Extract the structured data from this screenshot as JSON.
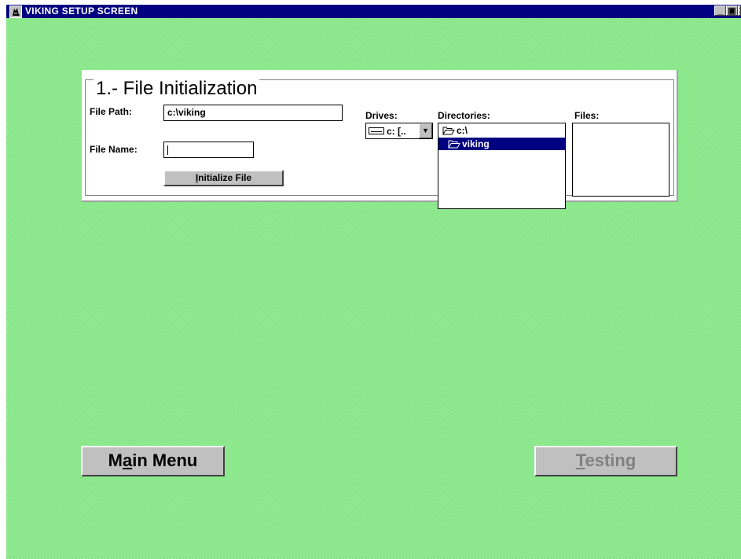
{
  "window": {
    "title": "VIKING  SETUP SCREEN",
    "controls": {
      "minimize": "_",
      "restore": "▣",
      "close": "✕"
    }
  },
  "section": {
    "title": "1.- File Initialization",
    "file_path": {
      "label": "File Path:",
      "value": "c:\\viking"
    },
    "file_name": {
      "label": "File Name:",
      "value": ""
    },
    "init_button": {
      "mnemonic": "I",
      "rest": "nitialize File"
    },
    "drives": {
      "label": "Drives:",
      "value": "c: [.."
    },
    "directories": {
      "label": "Directories:",
      "items": [
        {
          "name": "c:\\",
          "icon": "folder-open-icon",
          "selected": false
        },
        {
          "name": "viking",
          "icon": "folder-open-icon",
          "selected": true
        }
      ]
    },
    "files": {
      "label": "Files:",
      "items": []
    }
  },
  "main_menu_button": {
    "pre": "M",
    "mnemonic": "a",
    "post": "in Menu"
  },
  "testing_button": {
    "mnemonic": "T",
    "post": "esting",
    "disabled": true
  },
  "colors": {
    "background": "#90ee90",
    "titlebar": "#000080",
    "selection": "#000080",
    "button_face": "#c0c0c0",
    "disabled_text": "#808080"
  }
}
